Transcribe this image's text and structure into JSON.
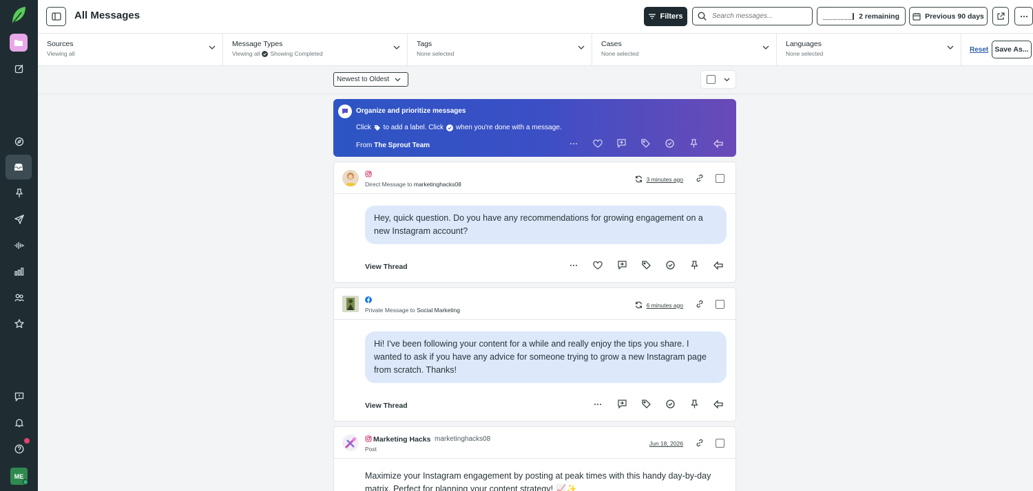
{
  "header": {
    "title": "All Messages",
    "filters_label": "Filters",
    "search_placeholder": "Search messages...",
    "remaining_label": "2 remaining",
    "period_label": "Previous 90 days"
  },
  "filters": {
    "sources": {
      "label": "Sources",
      "sub": "Viewing all"
    },
    "message_types": {
      "label": "Message Types",
      "sub": "Viewing all",
      "sub2": "Showing Completed"
    },
    "tags": {
      "label": "Tags",
      "sub": "None selected"
    },
    "cases": {
      "label": "Cases",
      "sub": "None selected"
    },
    "languages": {
      "label": "Languages",
      "sub": "None selected"
    },
    "reset_label": "Reset",
    "save_label": "Save As..."
  },
  "sort": {
    "selected": "Newest to Oldest"
  },
  "banner": {
    "title": "Organize and prioritize messages",
    "line_part1": "Click",
    "line_part2": "to add a label. Click",
    "line_part3": "when you're done with a message.",
    "from_prefix": "From",
    "from_name": "The Sprout Team"
  },
  "messages": [
    {
      "network": "instagram",
      "meta_prefix": "Direct Message to",
      "meta_target": "marketinghacks08",
      "time": "3 minutes ago",
      "text": "Hey, quick question. Do you have any recommendations for growing engagement on a new Instagram account?",
      "view_thread": "View Thread"
    },
    {
      "network": "facebook",
      "meta_prefix": "Private Message to",
      "meta_target": "Social Marketing",
      "time": "6 minutes ago",
      "text": "Hi! I've been following your content for a while and really enjoy the tips you share. I wanted to ask if you have any advice for someone trying to grow a new Instagram page from scratch. Thanks!",
      "view_thread": "View Thread"
    },
    {
      "network": "instagram",
      "author": "Marketing Hacks",
      "handle": "marketinghacks08",
      "type": "Post",
      "time": "Jun 18, 2026",
      "text": "Maximize your Instagram engagement by posting at peak times with this handy day-by-day matrix. Perfect for planning your content strategy! 📈✨"
    }
  ],
  "user": {
    "initials": "ME"
  },
  "colors": {
    "rail": "#1f2d33",
    "accent_green": "#2f8a4f",
    "banner_start": "#2d55c4",
    "banner_end": "#6a4ab8",
    "bubble": "#dde9fb",
    "link": "#2a5fa8"
  }
}
